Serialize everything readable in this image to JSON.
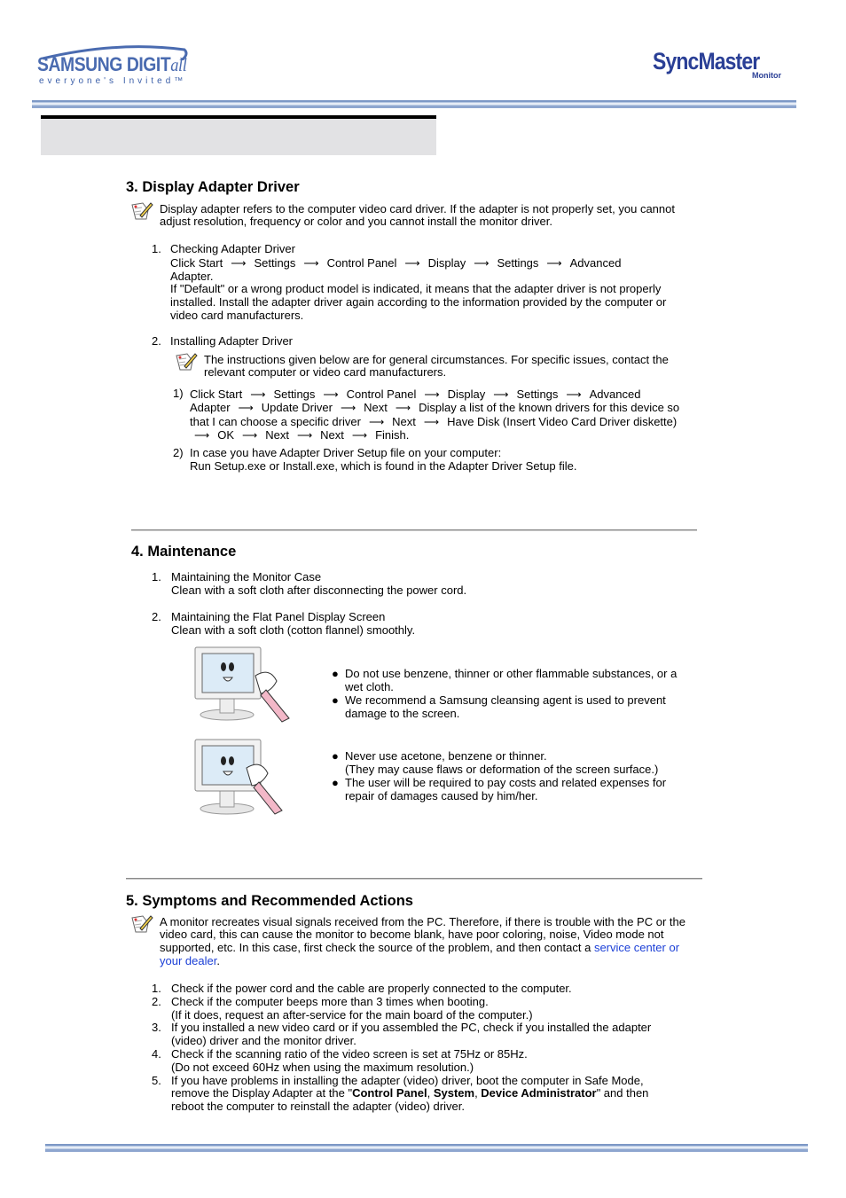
{
  "header": {
    "brand_logo_main": "SAMSUNG DIGIT",
    "brand_logo_italic": "all",
    "brand_tagline": "everyone's Invited™",
    "product_logo": "SyncMaster",
    "product_logo_sub": "Monitor"
  },
  "sections": {
    "display_adapter": {
      "title": "3. Display Adapter Driver",
      "note": [
        "Display adapter refers to the computer video card driver. If the adapter is not properly set, you cannot",
        "adjust resolution, frequency or color and you cannot install the monitor driver."
      ],
      "item1": {
        "number": "1.",
        "heading": "Checking Adapter Driver",
        "path": [
          "Click Start",
          "Settings",
          "Control Panel",
          "Display",
          "Settings",
          "Advanced"
        ],
        "path_tail": "Adapter.",
        "body": [
          "If \"Default\" or a wrong product model is indicated, it means that the adapter driver is not properly",
          "installed. Install the adapter driver again according to the information provided by the computer or",
          "video card manufacturers."
        ]
      },
      "item2": {
        "number": "2.",
        "heading": "Installing Adapter Driver",
        "note": [
          "The instructions given below are for general circumstances. For specific issues, contact the",
          "relevant computer or video card manufacturers."
        ],
        "step1": {
          "number": "1)",
          "line1": [
            "Click Start",
            "Settings",
            "Control Panel",
            "Display",
            "Settings",
            "Advanced"
          ],
          "line2": [
            "Adapter",
            "Update Driver",
            "Next",
            "Display a list of the known drivers for this device so"
          ],
          "line3": [
            "that I can choose a specific driver",
            "Next",
            "Have Disk (Insert Video Card Driver diskette)"
          ],
          "line4": [
            "",
            "OK",
            "Next",
            "Next",
            "Finish."
          ]
        },
        "step2": {
          "number": "2)",
          "lines": [
            "In case you have Adapter Driver Setup file on your computer:",
            "Run Setup.exe or Install.exe, which is found in the Adapter Driver Setup file."
          ]
        }
      }
    },
    "maintenance": {
      "title": "4. Maintenance",
      "item1": {
        "number": "1.",
        "heading": "Maintaining the Monitor Case",
        "body": "Clean with a soft cloth after disconnecting the power cord."
      },
      "item2": {
        "number": "2.",
        "heading": "Maintaining the Flat Panel Display Screen",
        "body": "Clean with a soft cloth (cotton flannel) smoothly."
      },
      "bullets_a": [
        [
          "Do not use benzene, thinner or other flammable substances, or a",
          "wet cloth."
        ],
        [
          "We recommend a Samsung cleansing agent is used to prevent",
          "damage to the screen."
        ]
      ],
      "bullets_b": [
        [
          "Never use acetone, benzene or thinner.",
          "(They may cause flaws or deformation of the screen surface.)"
        ],
        [
          "The user will be required to pay costs and related expenses for",
          "repair of damages caused by him/her."
        ]
      ]
    },
    "symptoms": {
      "title": "5. Symptoms and Recommended Actions",
      "note": [
        "A monitor recreates visual signals received from the PC. Therefore, if there is trouble with the PC or the",
        "video card, this can cause the monitor to become blank, have poor coloring, noise, Video mode not",
        "supported, etc. In this case, first check the source of the problem, and then contact a "
      ],
      "link_part1": "service center or",
      "link_part2": "your dealer",
      "link_suffix": ".",
      "items": [
        {
          "number": "1.",
          "lines": [
            "Check if the power cord and the cable are properly connected to the computer."
          ]
        },
        {
          "number": "2.",
          "lines": [
            "Check if the computer beeps more than 3 times when booting.",
            "(If it does, request an after-service for the main board of the computer.)"
          ]
        },
        {
          "number": "3.",
          "lines": [
            "If you installed a new video card or if you assembled the PC, check if you installed the adapter",
            "(video) driver and the monitor driver."
          ]
        },
        {
          "number": "4.",
          "lines": [
            "Check if the scanning ratio of the video screen is set at 75Hz or 85Hz.",
            "(Do not exceed 60Hz when using the maximum resolution.)"
          ]
        }
      ],
      "item5": {
        "number": "5.",
        "line1": "If you have problems in installing the adapter (video) driver, boot the computer in Safe Mode,",
        "line2_prefix": "remove the Display Adapter at the \"",
        "bold1": "Control Panel",
        "sep1": ", ",
        "bold2": "System",
        "sep2": ", ",
        "bold3": "Device Administrator",
        "line2_suffix": "\" and then",
        "line3": "reboot the computer to reinstall the adapter (video) driver."
      }
    }
  },
  "icons": {
    "arrow": "⟶",
    "bullet": "●"
  },
  "colors": {
    "link": "#1b3fd6",
    "brand_blue": "#2a3f96",
    "title_box": "#e2e2e4"
  }
}
